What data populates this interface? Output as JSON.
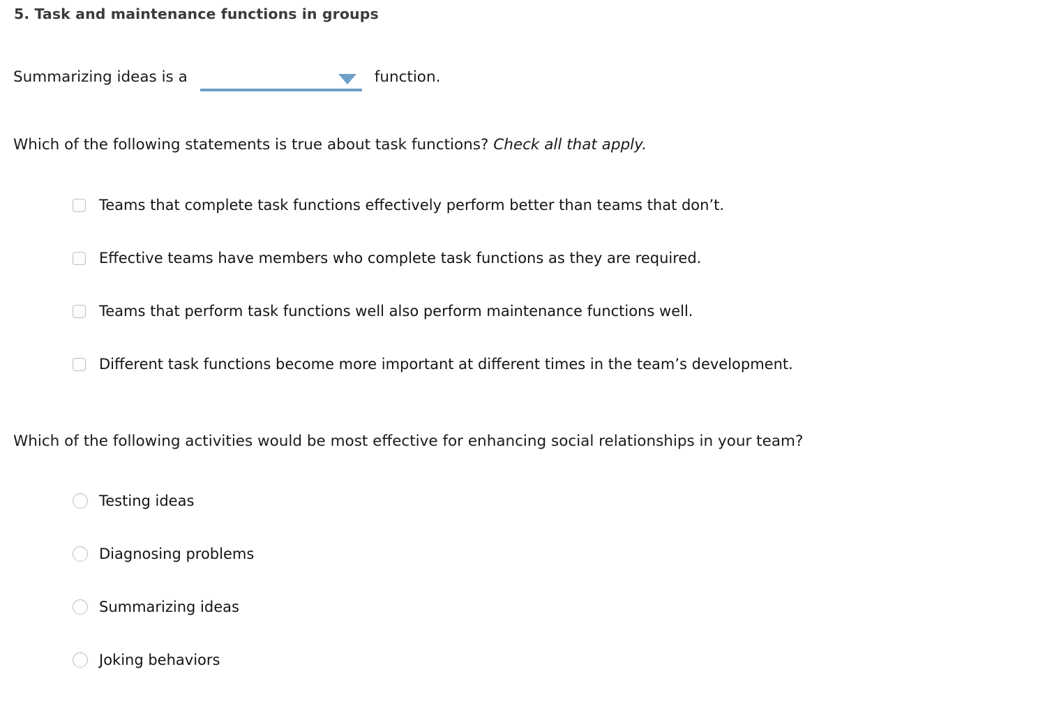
{
  "section": {
    "heading": "5. Task and maintenance functions in groups"
  },
  "fill_in_blank": {
    "lead_text": "Summarizing ideas is a",
    "trailing_text": "function.",
    "dropdown": {
      "name": "function-type-select",
      "selected_value": "",
      "placeholder": "",
      "arrow_icon": "chevron-down-icon",
      "accent_color": "#6d9fc8"
    }
  },
  "checkbox_question": {
    "prompt_main": "Which of the following statements is true about task functions?",
    "prompt_emphasis": "Check all that apply.",
    "options": [
      {
        "label": "Teams that complete task functions effectively perform better than teams that don’t.",
        "checked": false
      },
      {
        "label": "Effective teams have members who complete task functions as they are required.",
        "checked": false
      },
      {
        "label": "Teams that perform task functions well also perform maintenance functions well.",
        "checked": false
      },
      {
        "label": "Different task functions become more important at different times in the team’s development.",
        "checked": false
      }
    ]
  },
  "radio_question": {
    "prompt_main": "Which of the following activities would be most effective for enhancing social relationships in your team?",
    "options": [
      {
        "label": "Testing ideas",
        "selected": false
      },
      {
        "label": "Diagnosing problems",
        "selected": false
      },
      {
        "label": "Summarizing ideas",
        "selected": false
      },
      {
        "label": "Joking behaviors",
        "selected": false
      }
    ]
  },
  "theme": {
    "background": "#ffffff",
    "heading_color": "#3b3b3b",
    "text_color": "#1a1a1a",
    "accent_color": "#6d9fc8",
    "control_border": "#c0c0c0"
  }
}
